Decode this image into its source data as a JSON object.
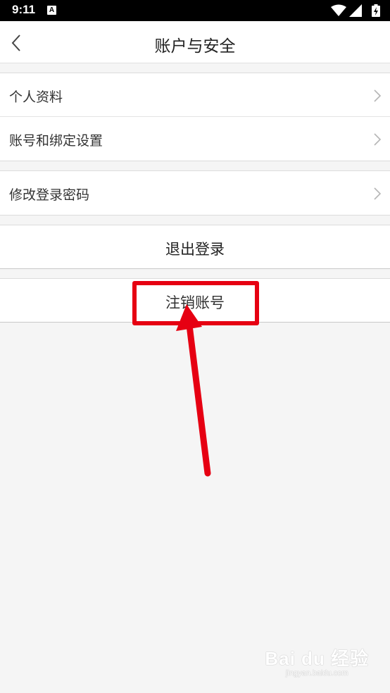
{
  "status_bar": {
    "time": "9:11",
    "notification_icon": "A"
  },
  "header": {
    "title": "账户与安全"
  },
  "groups": [
    {
      "items": [
        {
          "label": "个人资料"
        },
        {
          "label": "账号和绑定设置"
        }
      ]
    },
    {
      "items": [
        {
          "label": "修改登录密码"
        }
      ]
    }
  ],
  "actions": {
    "logout_label": "退出登录",
    "deregister_label": "注销账号"
  },
  "watermark": {
    "logo": "Bai du 经验",
    "url": "jingyan.baidu.com"
  },
  "colors": {
    "highlight": "#e60012",
    "background": "#f5f5f5"
  }
}
